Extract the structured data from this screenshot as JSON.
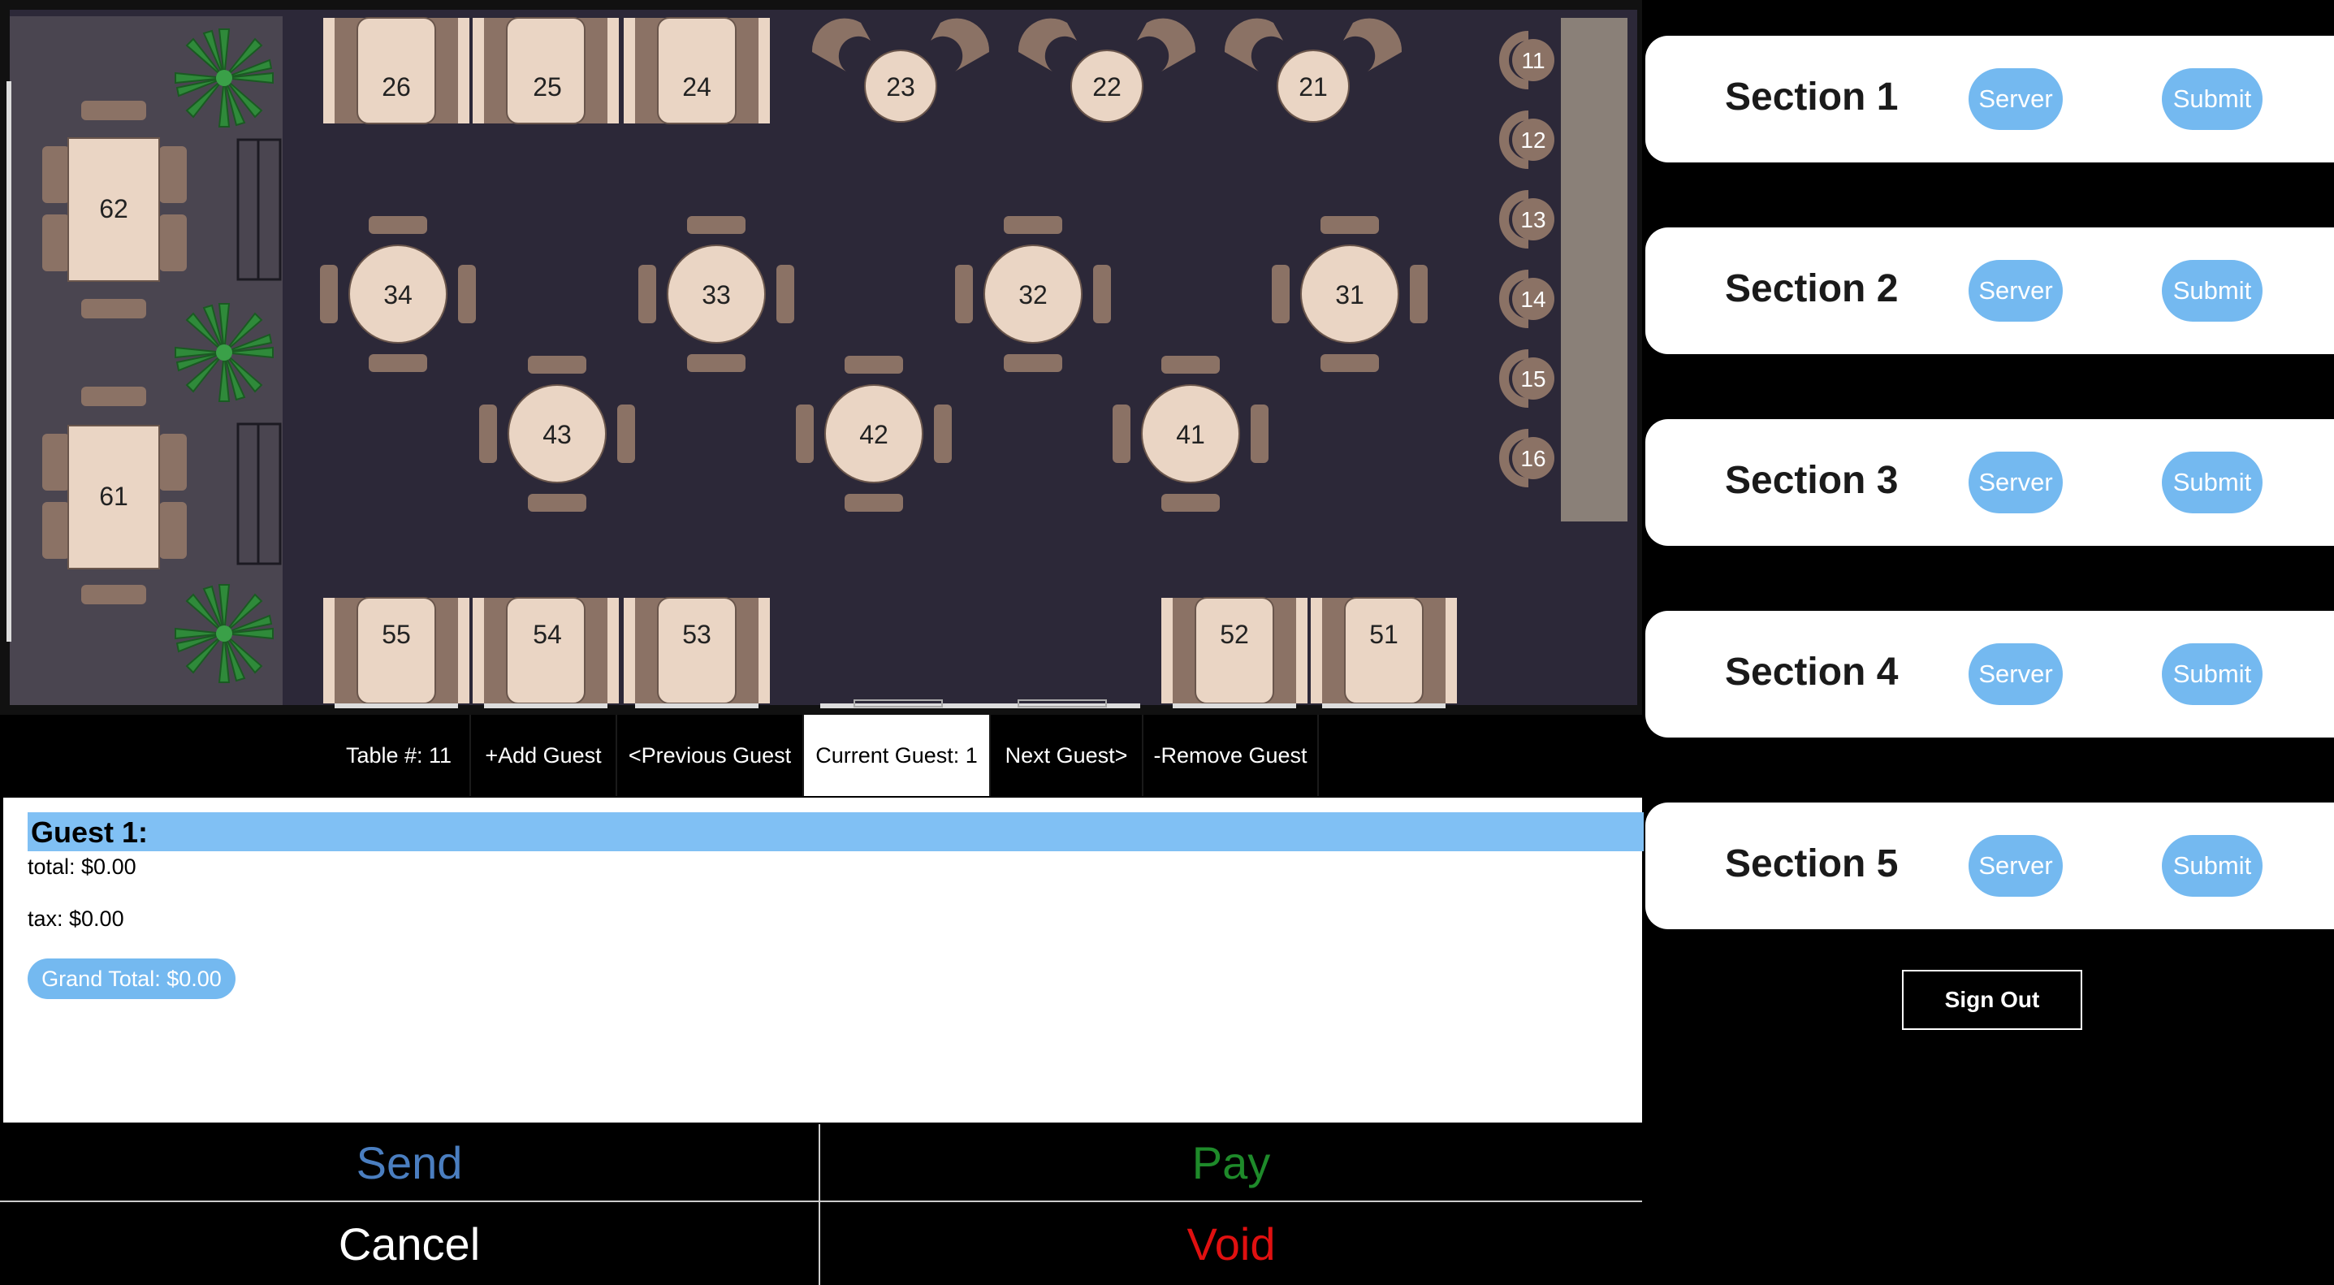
{
  "floor": {
    "colors": {
      "floor": "#2c2838",
      "booth_zone": "#4a4550",
      "bar": "#8a8078",
      "table": "#ead5c4",
      "chair": "#8b7265"
    },
    "tables": {
      "top_booths": [
        "26",
        "25",
        "24"
      ],
      "bar_tables_top": [
        "23",
        "22",
        "21"
      ],
      "bar_seats": [
        "11",
        "12",
        "13",
        "14",
        "15",
        "16"
      ],
      "left_tables": [
        "62",
        "61"
      ],
      "round_row1": [
        "34",
        "33",
        "32",
        "31"
      ],
      "round_row2": [
        "43",
        "42",
        "41"
      ],
      "bottom_booths_left": [
        "55",
        "54",
        "53"
      ],
      "bottom_booths_right": [
        "52",
        "51"
      ]
    }
  },
  "tabs": {
    "table": "Table #: 11",
    "add_guest": "+Add Guest",
    "previous_guest": "<Previous Guest",
    "current_guest": "Current Guest: 1",
    "next_guest": "Next Guest>",
    "remove_guest": "-Remove Guest"
  },
  "guest": {
    "heading": "Guest 1:",
    "total": "total: $0.00",
    "tax": "tax: $0.00",
    "grand_total": "Grand Total: $0.00"
  },
  "actions": {
    "send": "Send",
    "pay": "Pay",
    "cancel": "Cancel",
    "void": "Void",
    "colors": {
      "send": "#4a7ec0",
      "pay": "#1e8a2a",
      "cancel": "#ffffff",
      "void": "#e01010"
    }
  },
  "sections": [
    {
      "title": "Section 1",
      "server": "Server",
      "submit": "Submit"
    },
    {
      "title": "Section 2",
      "server": "Server",
      "submit": "Submit"
    },
    {
      "title": "Section 3",
      "server": "Server",
      "submit": "Submit"
    },
    {
      "title": "Section 4",
      "server": "Server",
      "submit": "Submit"
    },
    {
      "title": "Section 5",
      "server": "Server",
      "submit": "Submit"
    }
  ],
  "sign_out": "Sign Out",
  "accent": "#74b9f0"
}
